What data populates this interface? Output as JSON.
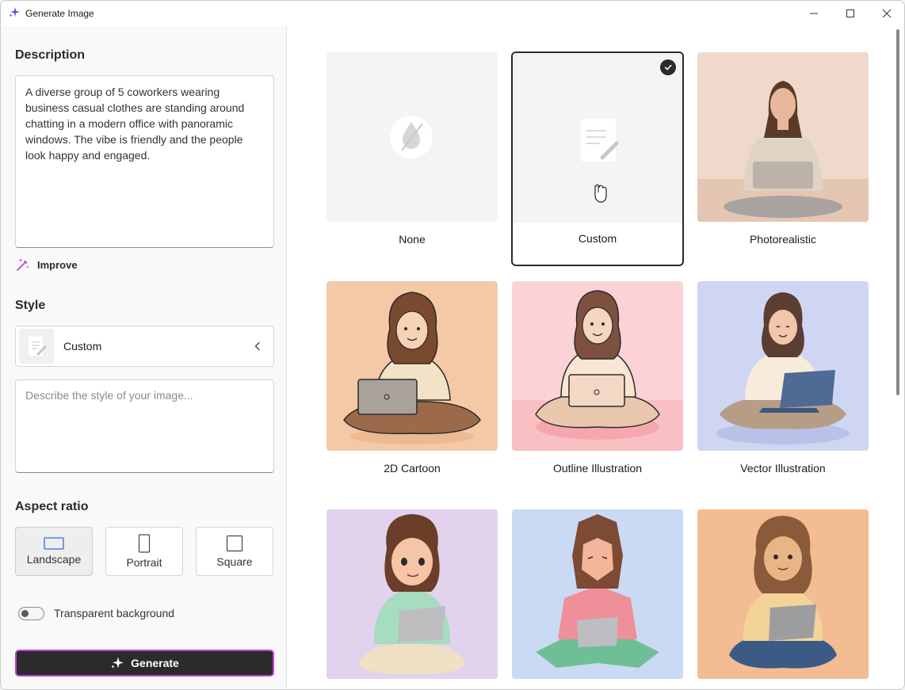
{
  "window": {
    "title": "Generate Image",
    "controls": {
      "minimize": "minimize-icon",
      "maximize": "maximize-icon",
      "close": "close-icon"
    }
  },
  "left": {
    "description_title": "Description",
    "description_value": "A diverse group of 5 coworkers wearing business casual clothes are standing around chatting in a modern office with panoramic windows. The vibe is friendly and the people look happy and engaged.",
    "improve_label": "Improve",
    "style_title": "Style",
    "style_selected": "Custom",
    "style_placeholder": "Describe the style of your image...",
    "aspect_title": "Aspect ratio",
    "aspect_options": [
      "Landscape",
      "Portrait",
      "Square"
    ],
    "aspect_selected": "Landscape",
    "transparent_label": "Transparent background",
    "transparent_on": false,
    "generate_label": "Generate"
  },
  "styles": [
    {
      "label": "None",
      "selected": false
    },
    {
      "label": "Custom",
      "selected": true
    },
    {
      "label": "Photorealistic",
      "selected": false
    },
    {
      "label": "2D Cartoon",
      "selected": false
    },
    {
      "label": "Outline Illustration",
      "selected": false
    },
    {
      "label": "Vector Illustration",
      "selected": false
    },
    {
      "label": "",
      "selected": false
    },
    {
      "label": "",
      "selected": false
    },
    {
      "label": "",
      "selected": false
    }
  ],
  "colors": {
    "accent": "#c13edb",
    "button_dark": "#2b2b2b",
    "cartoon_bg": "#f6c9a6",
    "outline_bg": "#fbd3d6",
    "vector_bg": "#cfd6f3",
    "photo_bg": "#ecd2c2"
  }
}
